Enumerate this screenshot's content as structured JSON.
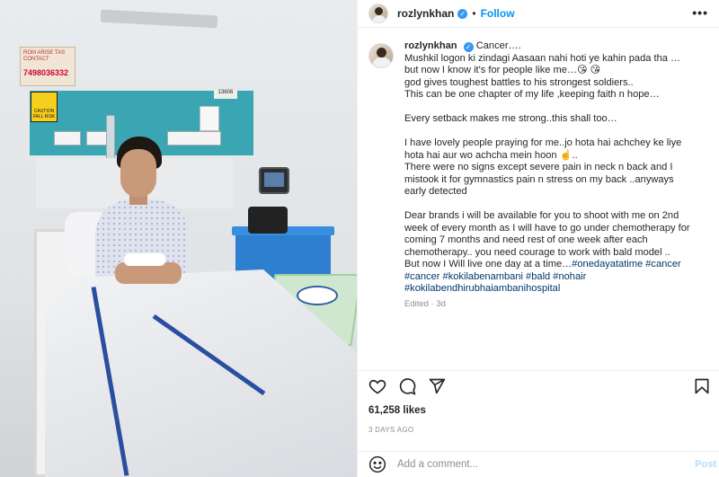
{
  "post": {
    "username": "rozlynkhan",
    "verified_mark": "✓",
    "separator": "•",
    "follow_label": "Follow",
    "more_label": "•••"
  },
  "caption": {
    "username": "rozlynkhan",
    "lines": [
      "Cancer….",
      "Mushkil logon ki zindagi Aasaan nahi hoti ye kahin pada tha …",
      "but now I know it's for people like me…😘 😘",
      "god gives toughest battles to his strongest soldiers..",
      "This can be one chapter of my life ,keeping faith n hope…",
      "",
      "Every setback makes me strong..this shall too…",
      "",
      "I have lovely people praying for me..jo hota hai achchey ke liye",
      "hota hai aur wo achcha mein hoon ☝️..",
      "There were no signs except severe pain in neck n back and I",
      "mistook it for gymnastics pain n stress on my back ..anyways",
      "early detected",
      "",
      "Dear brands i will be available for you to shoot with me on 2nd",
      "week of every month as I will have to go under chemotherapy for",
      "coming 7 months and need rest of one week after each",
      "chemotherapy.. you need courage to work with bald model ..",
      "But now I Will live one day at a time…"
    ],
    "hashtags_inline": "#onedayatatime #cancer",
    "hashtags": [
      "#cancer #kokilabenambani #bald #nohair",
      "#kokilabendhirubhaiambanihospital"
    ],
    "meta": "Edited · 3d"
  },
  "photo": {
    "sign_text": "ROM ARISE TAS CONTACT",
    "sign_number": "7498036332",
    "warning_text": "CAUTION FALL RISK",
    "room_number": "13606"
  },
  "actions": {
    "like_icon": "heart-icon",
    "comment_icon": "comment-icon",
    "share_icon": "share-icon",
    "save_icon": "bookmark-icon"
  },
  "likes": "61,258 likes",
  "time_ago": "3 DAYS AGO",
  "comment_box": {
    "placeholder": "Add a comment...",
    "post_label": "Post",
    "emoji_icon": "emoji-icon"
  }
}
